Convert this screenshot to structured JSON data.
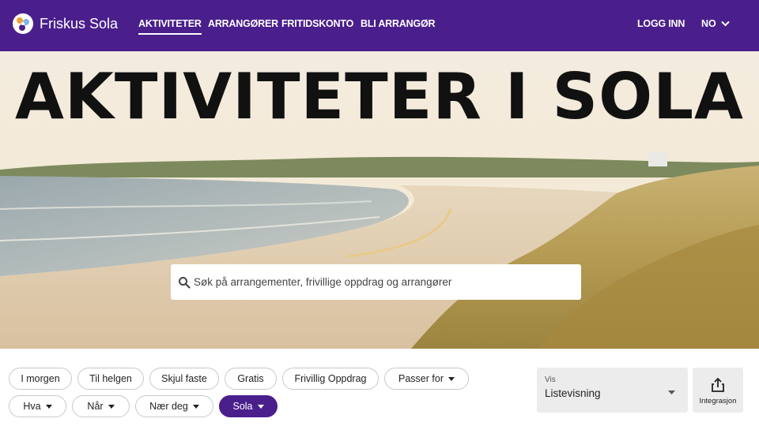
{
  "header": {
    "brand": "Friskus Sola",
    "nav": [
      "AKTIVITETER",
      "ARRANGØRER",
      "FRITIDSKONTO",
      "BLI ARRANGØR"
    ],
    "active_nav": "AKTIVITETER",
    "login": "LOGG INN",
    "language": "NO",
    "brand_color": "#4a1f8c"
  },
  "hero": {
    "title": "AKTIVITETER I SOLA",
    "search_placeholder": "Søk på arrangementer, frivillige oppdrag og arrangører"
  },
  "filters": {
    "row1": [
      "I morgen",
      "Til helgen",
      "Skjul faste",
      "Gratis",
      "Frivillig Oppdrag",
      "Passer for"
    ],
    "row2": [
      "Hva",
      "Når",
      "Nær deg",
      "Sola"
    ],
    "selected": "Sola"
  },
  "view": {
    "label": "Vis",
    "value": "Listevisning"
  },
  "integration": {
    "label": "Integrasjon",
    "icon": "share-icon"
  }
}
